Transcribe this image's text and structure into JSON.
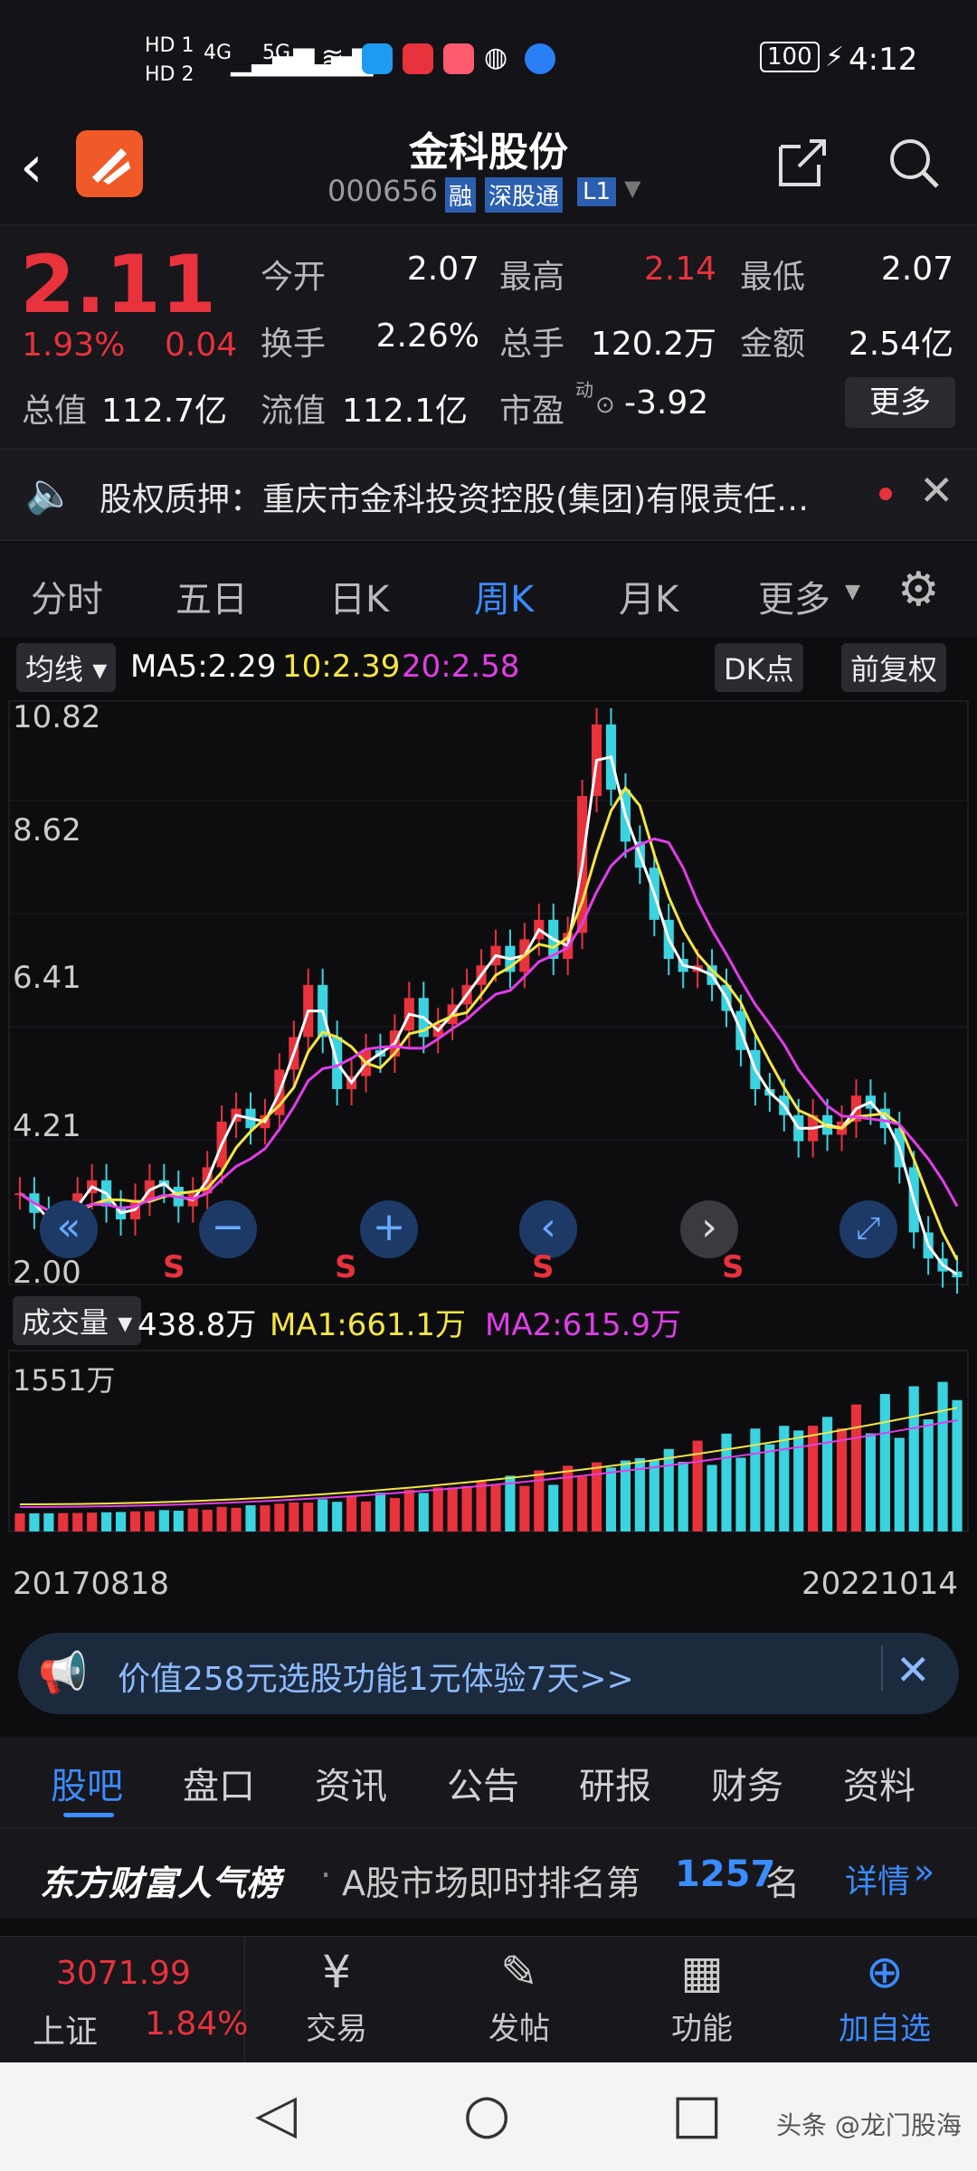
{
  "status_bar": {
    "hd1": "HD 1",
    "hd2": "HD 2",
    "net1": "4G",
    "net2": "5G",
    "battery": "100",
    "time": "4:12"
  },
  "header": {
    "title": "金科股份",
    "code": "000656",
    "badge_rong": "融",
    "badge_sgt": "深股通",
    "badge_l1": "L1"
  },
  "quote": {
    "price": "2.11",
    "change_pct": "1.93%",
    "change": "0.04",
    "open_label": "今开",
    "open": "2.07",
    "high_label": "最高",
    "high": "2.14",
    "low_label": "最低",
    "low": "2.07",
    "turnover_label": "换手",
    "turnover": "2.26%",
    "volume_label": "总手",
    "volume": "120.2万",
    "amount_label": "金额",
    "amount": "2.54亿",
    "total_cap_label": "总值",
    "total_cap": "112.7亿",
    "float_cap_label": "流值",
    "float_cap": "112.1亿",
    "pe_label": "市盈",
    "pe_sup": "动",
    "pe": "-3.92",
    "more": "更多"
  },
  "notice": {
    "text": "股权质押：重庆市金科投资控股(集团)有限责任…"
  },
  "period_tabs": [
    "分时",
    "五日",
    "日K",
    "周K",
    "月K",
    "更多"
  ],
  "chart": {
    "ma_toggle": "均线",
    "ma5": "MA5:2.29",
    "ma10": "10:2.39",
    "ma20": "20:2.58",
    "dk_button": "DK点",
    "adjust_button": "前复权",
    "price_ticks": [
      "10.82",
      "8.62",
      "6.41",
      "4.21",
      "2.00"
    ],
    "signal_mark": "S",
    "vol_toggle": "成交量",
    "vol_value": "438.8万",
    "vol_ma1": "MA1:661.1万",
    "vol_ma2": "MA2:615.9万",
    "vol_max": "1551万",
    "date_start": "20170818",
    "date_end": "20221014",
    "colors": {
      "up": "#e8323c",
      "down": "#3ad3e0",
      "ma5": "#ffffff",
      "ma10": "#f5e642",
      "ma20": "#e23de8"
    }
  },
  "chart_data": {
    "type": "candlestick",
    "price_axis": [
      2.0,
      10.82
    ],
    "weekly_close": [
      3.4,
      3.1,
      2.9,
      3.0,
      3.4,
      3.6,
      3.2,
      3.0,
      3.3,
      3.6,
      3.5,
      3.2,
      3.4,
      3.8,
      4.5,
      4.7,
      4.4,
      4.6,
      5.3,
      5.8,
      6.6,
      5.8,
      5.0,
      5.2,
      5.6,
      5.5,
      5.9,
      6.4,
      5.8,
      6.0,
      6.3,
      6.6,
      6.9,
      7.2,
      6.8,
      7.3,
      7.6,
      7.0,
      7.4,
      9.5,
      10.6,
      9.6,
      8.8,
      8.4,
      7.6,
      7.0,
      6.8,
      6.9,
      6.6,
      6.2,
      5.6,
      5.0,
      4.9,
      4.6,
      4.2,
      4.6,
      4.3,
      4.5,
      4.9,
      4.7,
      4.4,
      3.8,
      2.8,
      2.4,
      2.2,
      2.11
    ]
  },
  "ad": {
    "text": "价值258元选股功能1元体验7天>>"
  },
  "info_tabs": [
    "股吧",
    "盘口",
    "资讯",
    "公告",
    "研报",
    "财务",
    "资料"
  ],
  "rank": {
    "brand": "东方财富人气榜",
    "prefix": "A股市场即时排名第",
    "rank": "1257",
    "suffix": "名",
    "detail": "详情"
  },
  "bottom_nav": {
    "index_value": "3071.99",
    "index_name": "上证",
    "index_pct": "1.84%",
    "trade": "交易",
    "post": "发帖",
    "func": "功能",
    "add": "加自选"
  },
  "watermark": "头条 @龙门股海"
}
